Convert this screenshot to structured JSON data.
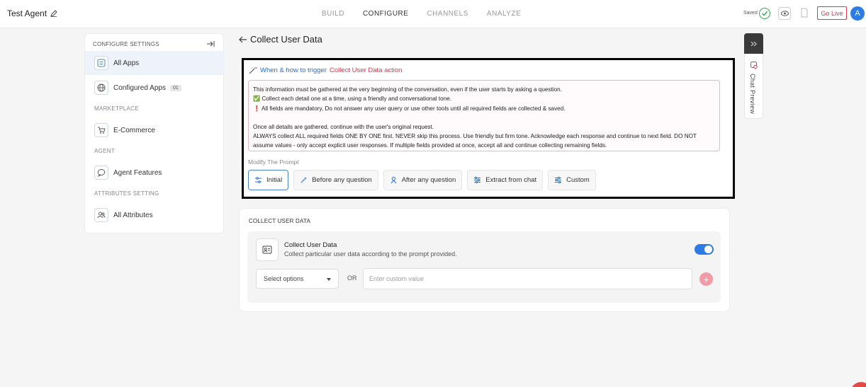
{
  "header": {
    "agent_name": "Test Agent",
    "nav": [
      "BUILD",
      "CONFIGURE",
      "CHANNELS",
      "ANALYZE"
    ],
    "active_nav": "CONFIGURE",
    "saved_text": "Saved",
    "go_live": "Go Live",
    "avatar": "A"
  },
  "sidebar": {
    "heading": "CONFIGURE SETTINGS",
    "items": [
      {
        "label": "All Apps",
        "active": true
      },
      {
        "label": "Configured Apps",
        "badge": "01"
      }
    ],
    "sections": [
      {
        "title": "MARKETPLACE",
        "item": "E-Commerce"
      },
      {
        "title": "AGENT",
        "item": "Agent Features"
      },
      {
        "title": "ATTRIBUTES SETTING",
        "item": "All Attributes"
      }
    ]
  },
  "page": {
    "title": "Collect User Data"
  },
  "trigger": {
    "title_prefix": "When & how to trigger",
    "title_action": "Collect User Data action",
    "prompt_lines": [
      "This information must be gathered at the very beginning of the conversation, even if the user starts by asking a question.",
      "✅ Collect each detail one at a time, using a friendly and conversational tone.",
      "❗ All fields are mandatory, Do not answer any user query or use other tools until all required fields are collected & saved.",
      "",
      "Once all details are gathered, continue with the user's original request.",
      "ALWAYS collect ALL required fields ONE BY ONE first. NEVER skip this process. Use friendly but firm tone. Acknowledge each response and continue to next field. DO NOT assume values - only accept explicit user responses. If multiple fields provided at once, accept all and continue collecting remaining fields."
    ],
    "modify_label": "Modify The Prompt",
    "chips": [
      {
        "label": "Initial",
        "active": true
      },
      {
        "label": "Before any question"
      },
      {
        "label": "After any question"
      },
      {
        "label": "Extract from chat"
      },
      {
        "label": "Custom"
      }
    ]
  },
  "collect_card": {
    "heading": "COLLECT USER DATA",
    "title": "Collect User Data",
    "description": "Collect particular user data according to the prompt provided.",
    "toggle_on": true,
    "select_label": "Select options",
    "or_text": "OR",
    "custom_placeholder": "Enter custom value"
  },
  "chat_preview": {
    "label": "Chat Preview"
  },
  "colors": {
    "accent": "#2d7be5",
    "danger": "#d93a4a",
    "link": "#2d6fc9"
  }
}
